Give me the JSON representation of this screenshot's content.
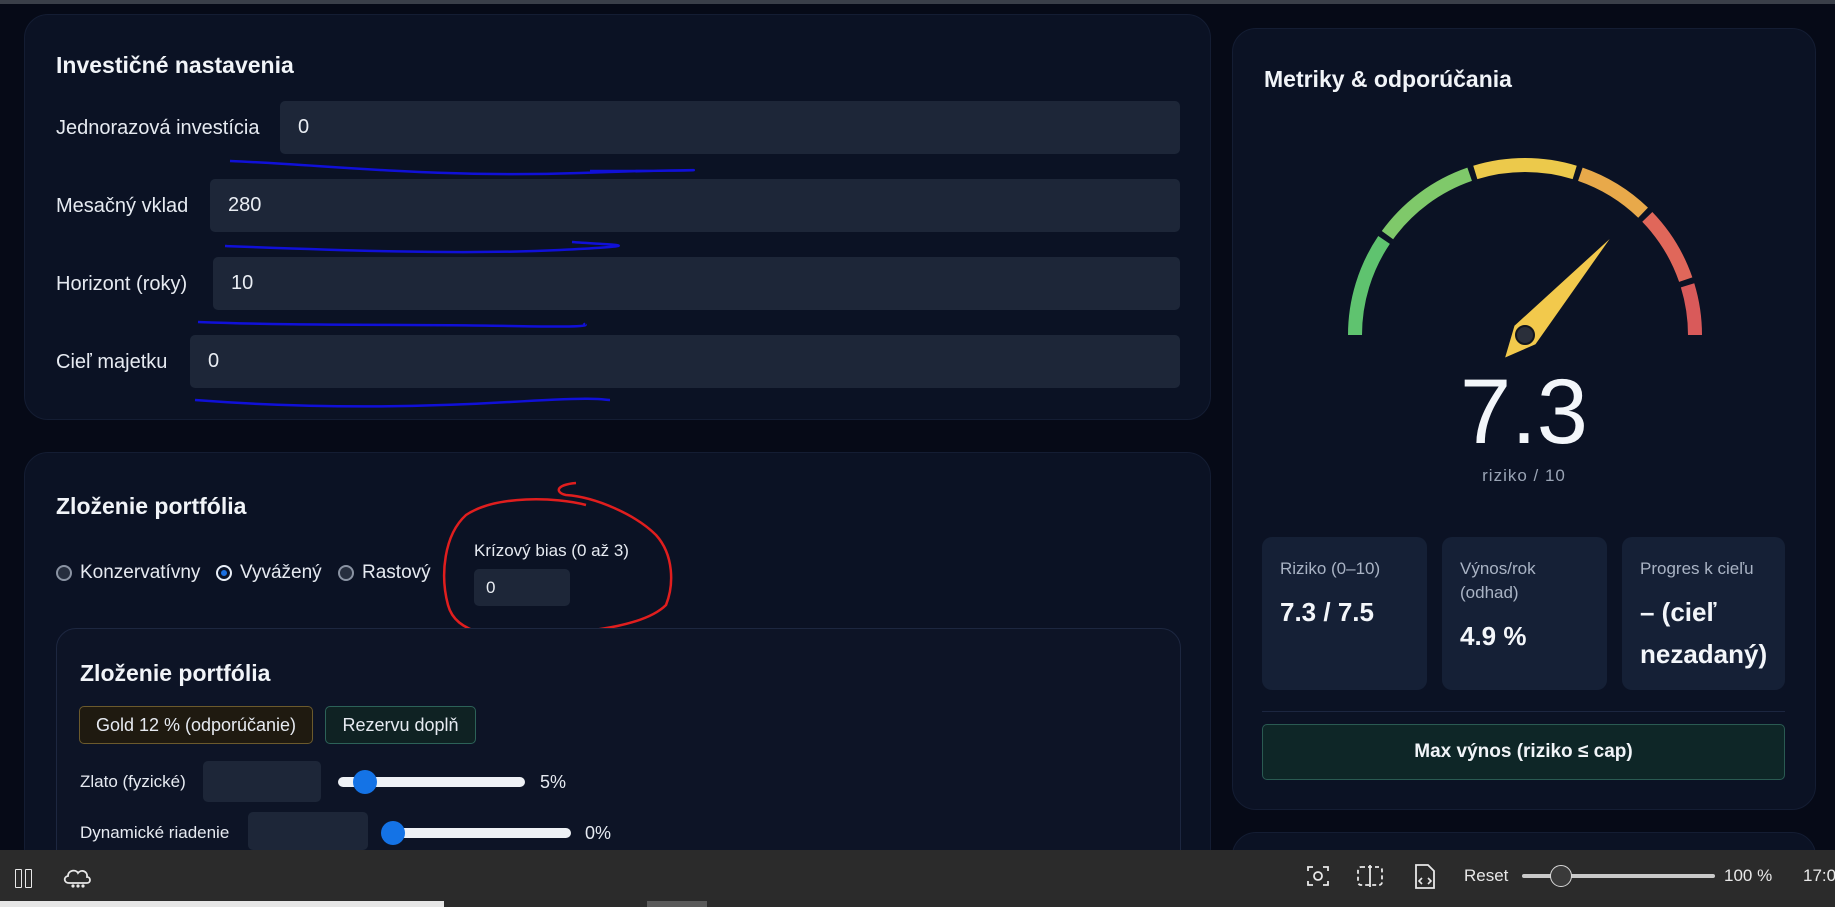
{
  "investment": {
    "title": "Investičné nastavenia",
    "fields": [
      {
        "label": "Jednorazová investícia",
        "value": "0"
      },
      {
        "label": "Mesačný vklad",
        "value": "280"
      },
      {
        "label": "Horizont (roky)",
        "value": "10"
      },
      {
        "label": "Cieľ majetku",
        "value": "0"
      }
    ]
  },
  "portfolio": {
    "title": "Zloženie portfólia",
    "profiles": [
      {
        "label": "Konzervatívny",
        "selected": false
      },
      {
        "label": "Vyvážený",
        "selected": true
      },
      {
        "label": "Rastový",
        "selected": false
      }
    ],
    "crisis_label": "Krízový bias (0 až 3)",
    "crisis_value": "0",
    "inner": {
      "title": "Zloženie portfólia",
      "buttons": [
        "Gold 12 % (odporúčanie)",
        "Rezervu doplň"
      ],
      "rows": [
        {
          "label": "Zlato (fyzické)",
          "value": "",
          "percent": "5%",
          "fraction": 0.05
        },
        {
          "label": "Dynamické riadenie",
          "value": "",
          "percent": "0%",
          "fraction": 0.0
        }
      ]
    }
  },
  "metrics": {
    "title": "Metriky & odporúčania",
    "gauge_value": "7.3",
    "gauge_caption": "riziko / 10",
    "gauge_level": 7.3,
    "gauge_max": 10,
    "boxes": [
      {
        "title": "Riziko (0–10)",
        "value": "7.3 / 7.5"
      },
      {
        "title": "Výnos/rok (odhad)",
        "value": "4.9 %"
      },
      {
        "title": "Progres k cieľu",
        "value": "– (cieľ nezadaný)"
      }
    ],
    "max_button": "Max výnos (riziko ≤ cap)"
  },
  "taskbar": {
    "reset_label": "Reset",
    "zoom": "100 %",
    "time": "17:0",
    "zoom_fraction": 0.2
  },
  "colors": {
    "accent_blue": "#1473e6",
    "annotation_blue": "#1010d8",
    "annotation_red": "#e01e1e",
    "gauge_green": "#5fc36f",
    "gauge_yellow": "#ecc94b",
    "gauge_orange": "#e8a94a",
    "gauge_red": "#e0675a",
    "needle": "#f2c94c"
  },
  "icons": [
    "pause-icon",
    "cloud-icon",
    "screenshot-icon",
    "split-view-icon",
    "code-file-icon"
  ]
}
